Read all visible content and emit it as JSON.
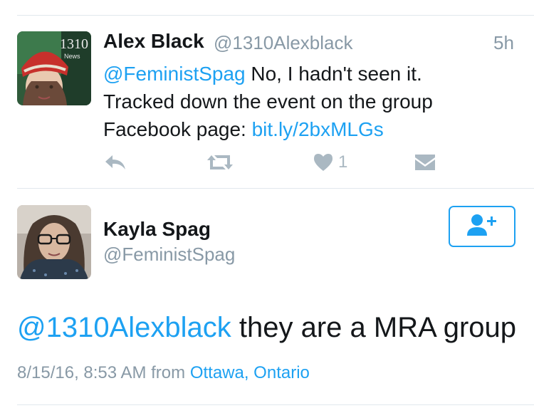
{
  "tweet1": {
    "author_name": "Alex Black",
    "author_handle": "@1310Alexblack",
    "time": "5h",
    "mention": "@FeministSpag",
    "text_line1": " No, I hadn't seen it.",
    "text_line2": "Tracked down the event on the group",
    "text_line3_prefix": "Facebook page: ",
    "link": "bit.ly/2bxMLGs",
    "avatar_text_1310": "1310",
    "avatar_text_news": "News",
    "like_count": "1",
    "icons": [
      "reply-icon",
      "retweet-icon",
      "heart-icon",
      "dm-icon"
    ]
  },
  "tweet2": {
    "author_name": "Kayla Spag",
    "author_handle": "@FeministSpag",
    "mention": "@1310Alexblack",
    "text": " they are a MRA group",
    "timestamp": "8/15/16, 8:53 AM from ",
    "location": "Ottawa, Ontario",
    "follow_icon": "add-user-icon"
  },
  "colors": {
    "link": "#1da1f2",
    "muted": "#8899a6",
    "icon": "#aab8c2",
    "divider": "#e1e8ed"
  }
}
